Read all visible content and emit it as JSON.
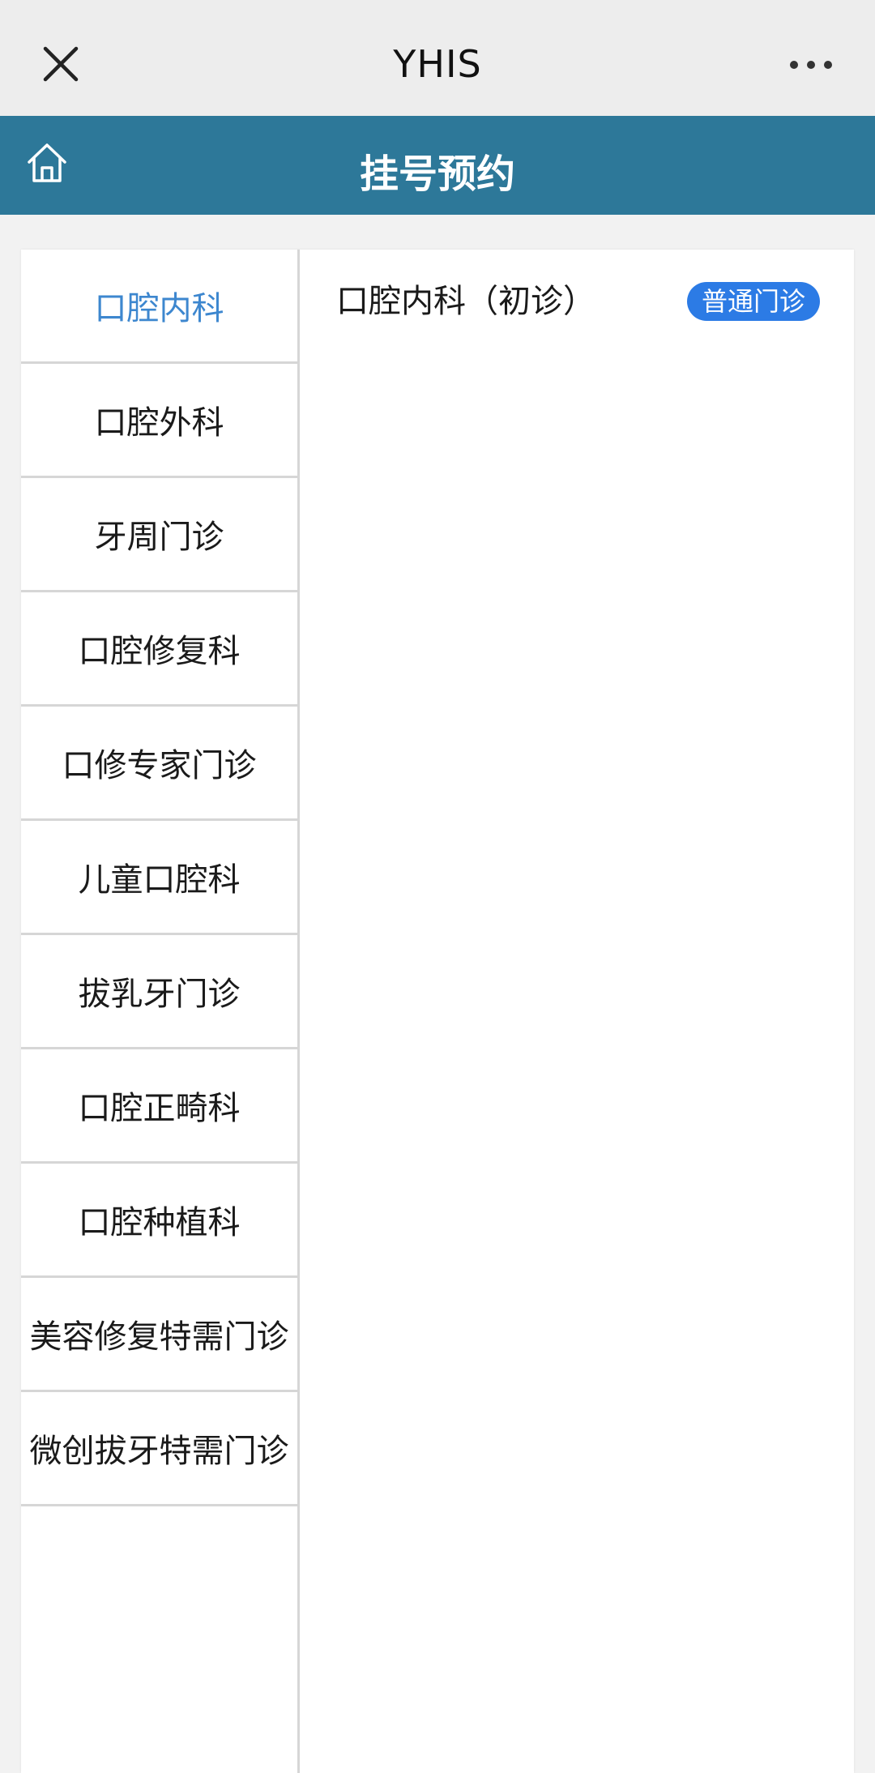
{
  "window": {
    "title": "YHIS"
  },
  "header": {
    "title": "挂号预约"
  },
  "sidebar": {
    "items": [
      {
        "label": "口腔内科"
      },
      {
        "label": "口腔外科"
      },
      {
        "label": "牙周门诊"
      },
      {
        "label": "口腔修复科"
      },
      {
        "label": "口修专家门诊"
      },
      {
        "label": "儿童口腔科"
      },
      {
        "label": "拔乳牙门诊"
      },
      {
        "label": "口腔正畸科"
      },
      {
        "label": "口腔种植科"
      },
      {
        "label": "美容修复特需门诊"
      },
      {
        "label": "微创拔牙特需门诊"
      }
    ],
    "active_index": 0
  },
  "content": {
    "entries": [
      {
        "name": "口腔内科（初诊）",
        "badge": "普通门诊"
      }
    ]
  },
  "icons": {
    "close": "close-icon",
    "more": "more-icon",
    "home": "home-icon"
  },
  "colors": {
    "header_bg": "#2d7899",
    "active_text": "#3d87cf",
    "badge_bg": "#2c7be5"
  }
}
